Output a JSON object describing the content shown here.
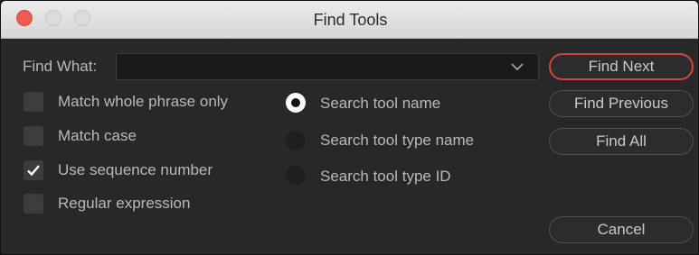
{
  "window": {
    "title": "Find Tools"
  },
  "find": {
    "label": "Find What:",
    "value": ""
  },
  "buttons": {
    "find_next": "Find Next",
    "find_previous": "Find Previous",
    "find_all": "Find All",
    "cancel": "Cancel"
  },
  "options": [
    {
      "label": "Match whole phrase only",
      "checked": false
    },
    {
      "label": "Match case",
      "checked": false
    },
    {
      "label": "Use sequence number",
      "checked": true
    },
    {
      "label": "Regular expression",
      "checked": false
    }
  ],
  "search_modes": [
    {
      "label": "Search tool name",
      "selected": true
    },
    {
      "label": "Search tool type name",
      "selected": false
    },
    {
      "label": "Search tool type ID",
      "selected": false
    }
  ],
  "colors": {
    "accent": "#d2463e",
    "close_button": "#ef5a52",
    "background": "#282828"
  }
}
